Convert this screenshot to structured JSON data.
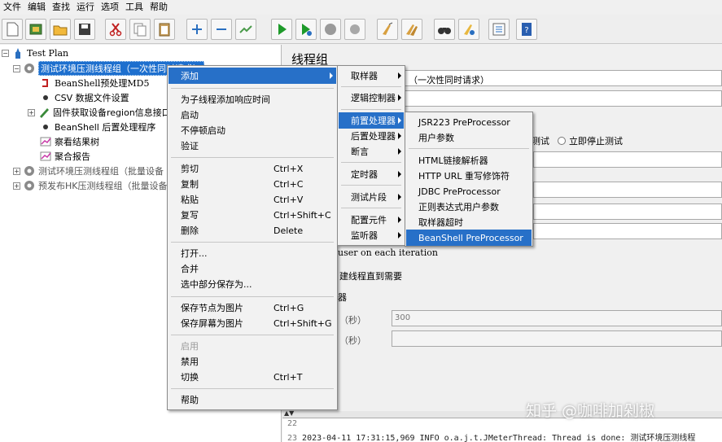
{
  "menubar": [
    "文件",
    "编辑",
    "查找",
    "运行",
    "选项",
    "工具",
    "帮助"
  ],
  "tree": {
    "items": [
      {
        "label": "Test Plan"
      },
      {
        "label": "测试环境压测线程组（一次性同时请求）"
      },
      {
        "label": "BeanShell预处理MD5"
      },
      {
        "label": "CSV 数据文件设置"
      },
      {
        "label": "固件获取设备region信息接口"
      },
      {
        "label": "BeanShell 后置处理程序"
      },
      {
        "label": "察看结果树"
      },
      {
        "label": "聚合报告"
      },
      {
        "label": "测试环境压测线程组（批量设备"
      },
      {
        "label": "预发布HK压测线程组（批量设备"
      }
    ]
  },
  "panel": {
    "title": "线程组",
    "name_fragment": "（一次性同时请求）",
    "radio_test": "测试",
    "radio_stop_now": "立即停止测试",
    "loop_fragment": "user on each iteration",
    "delay_fragment": "建线程直到需要",
    "scheduler_fragment": "器",
    "duration_label": "（秒）",
    "duration_value": "300",
    "startup_delay_label": "（秒）"
  },
  "context_menu": {
    "items": [
      {
        "label": "添加",
        "shortcut": ""
      },
      {
        "label": "为子线程添加响应时间",
        "shortcut": ""
      },
      {
        "label": "启动",
        "shortcut": ""
      },
      {
        "label": "不停顿启动",
        "shortcut": ""
      },
      {
        "label": "验证",
        "shortcut": ""
      },
      {
        "label": "剪切",
        "shortcut": "Ctrl+X"
      },
      {
        "label": "复制",
        "shortcut": "Ctrl+C"
      },
      {
        "label": "粘贴",
        "shortcut": "Ctrl+V"
      },
      {
        "label": "复写",
        "shortcut": "Ctrl+Shift+C"
      },
      {
        "label": "删除",
        "shortcut": "Delete"
      },
      {
        "label": "打开...",
        "shortcut": ""
      },
      {
        "label": "合并",
        "shortcut": ""
      },
      {
        "label": "选中部分保存为...",
        "shortcut": ""
      },
      {
        "label": "保存节点为图片",
        "shortcut": "Ctrl+G"
      },
      {
        "label": "保存屏幕为图片",
        "shortcut": "Ctrl+Shift+G"
      },
      {
        "label": "启用",
        "shortcut": ""
      },
      {
        "label": "禁用",
        "shortcut": ""
      },
      {
        "label": "切换",
        "shortcut": "Ctrl+T"
      },
      {
        "label": "帮助",
        "shortcut": ""
      }
    ]
  },
  "add_menu": {
    "items": [
      "取样器",
      "逻辑控制器",
      "前置处理器",
      "后置处理器",
      "断言",
      "定时器",
      "测试片段",
      "配置元件",
      "监听器"
    ]
  },
  "pre_menu": {
    "items": [
      "JSR223 PreProcessor",
      "用户参数",
      "HTML链接解析器",
      "HTTP URL 重写修饰符",
      "JDBC PreProcessor",
      "正则表达式用户参数",
      "取样器超时",
      "BeanShell PreProcessor"
    ]
  },
  "log": {
    "lines": [
      {
        "num": "22",
        "text": ""
      },
      {
        "num": "23",
        "text": "2023-04-11 17:31:15,969 INFO o.a.j.t.JMeterThread: Thread is done: 测试环境压测线程"
      }
    ]
  },
  "watermark": "知乎 @咖啡加剁椒"
}
